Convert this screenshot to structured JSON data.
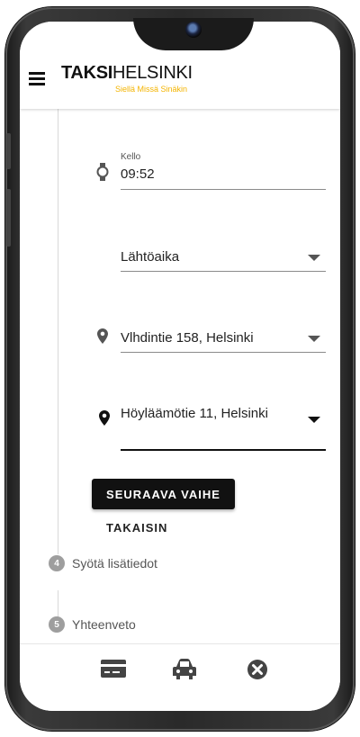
{
  "header": {
    "logo_bold": "TAKSI",
    "logo_light": "HELSINKI",
    "logo_tagline": "Siellä Missä Sinäkin"
  },
  "form": {
    "time_label": "Kello",
    "time_value": "09:52",
    "departure_type": "Lähtöaika",
    "from_address": "Vlhdintie 158, Helsinki",
    "to_address": "Höyläämötie 11, Helsinki"
  },
  "actions": {
    "next_label": "SEURAAVA VAIHE",
    "back_label": "TAKAISIN"
  },
  "steps": [
    {
      "number": "4",
      "label": "Syötä lisätiedot"
    },
    {
      "number": "5",
      "label": "Yhteenveto"
    }
  ],
  "bottom_nav": {
    "icons": [
      "credit-card-icon",
      "car-icon",
      "close-circle-icon"
    ]
  },
  "colors": {
    "accent": "#f4b400",
    "button_bg": "#111111",
    "step_badge": "#9e9e9e"
  }
}
